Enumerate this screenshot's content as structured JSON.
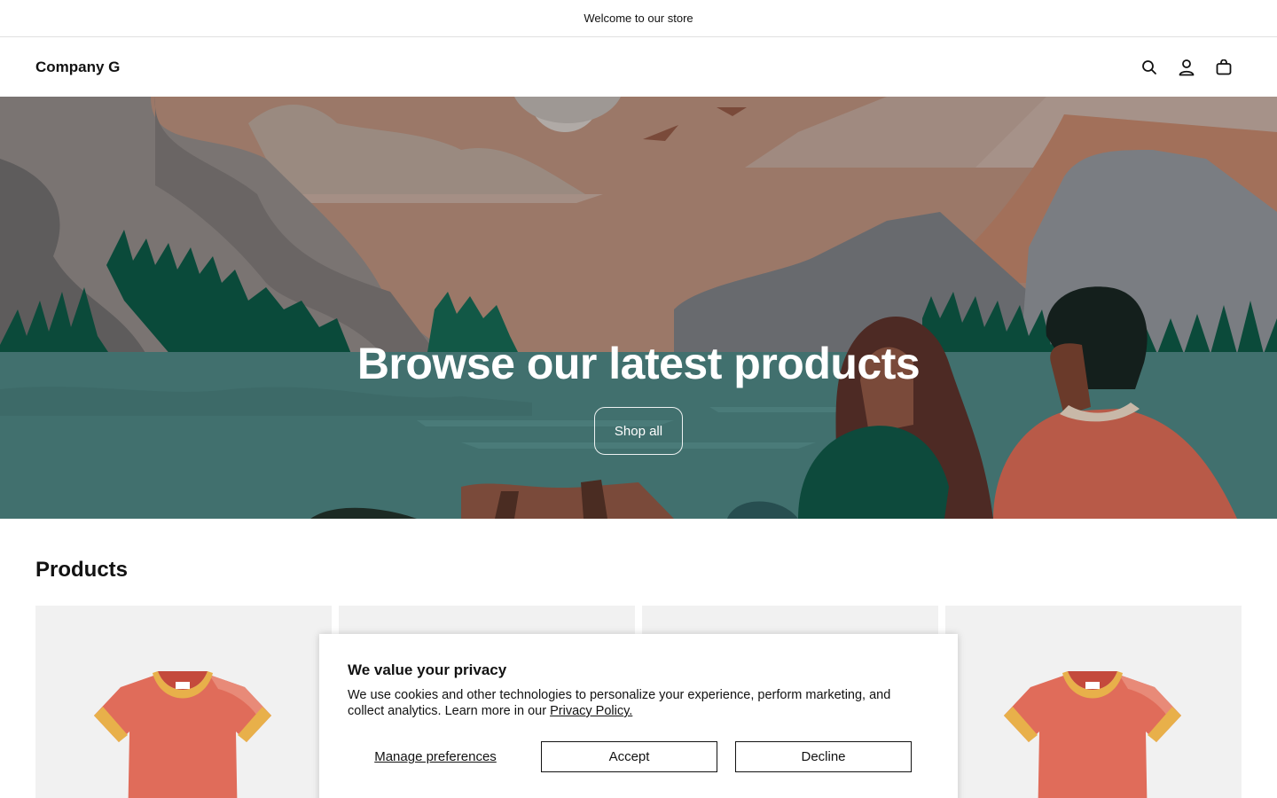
{
  "announcement": {
    "text": "Welcome to our store"
  },
  "header": {
    "logo": "Company G",
    "icons": [
      "search-icon",
      "account-icon",
      "cart-icon"
    ]
  },
  "hero": {
    "title": "Browse our latest products",
    "button_label": "Shop all"
  },
  "products": {
    "heading": "Products",
    "items": [
      {
        "image": "t-shirt"
      },
      {
        "image": "product"
      },
      {
        "image": "product"
      },
      {
        "image": "t-shirt"
      }
    ]
  },
  "cookie_banner": {
    "title": "We value your privacy",
    "text": "We use cookies and other technologies to personalize your experience, perform marketing, and collect analytics. Learn more in our",
    "link_label": "Privacy Policy.",
    "manage_label": "Manage preferences",
    "accept_label": "Accept",
    "decline_label": "Decline"
  },
  "colors": {
    "text": "#121212",
    "lake": "#41706e",
    "sky": "#9e7767",
    "forest": "#0a4a3a",
    "shirt": "#e06c5a",
    "collar": "#e8b04a"
  }
}
